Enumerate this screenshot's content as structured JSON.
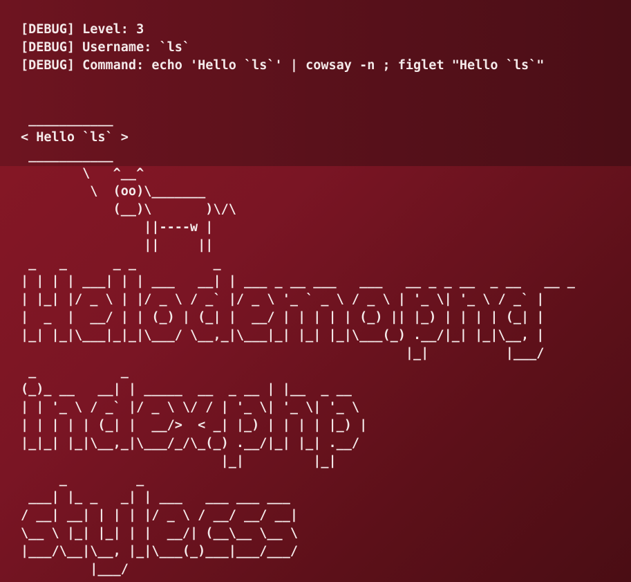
{
  "debug": {
    "level_line": "[DEBUG] Level: 3",
    "username_line": "[DEBUG] Username: `ls`",
    "command_line": "[DEBUG] Command: echo 'Hello `ls`' | cowsay -n ; figlet \"Hello `ls`\""
  },
  "cowsay": {
    "output": " ___________\n< Hello `ls` >\n ___________\n        \\   ^__^\n         \\  (oo)\\_______\n            (__)\\       )\\/\\\n                ||----w |\n                ||     ||"
  },
  "figlet": {
    "output": " _   _      _ _          _                                      \n| | | | ___| | | ___   __| | ___ _ __ ___   ___   __ _ _ __  _ __   __ _ \n| |_| |/ _ \\ | |/ _ \\ / _` |/ _ \\ '_ ` _ \\ / _ \\ | '_ \\| '_ \\ / _` |\n|  _  |  __/ | | (_) | (_| |  __/ | | | | | (_) || |_) | | | | (_| |\n|_| |_|\\___|_|_|\\___/ \\__,_|\\___|_| |_| |_|\\___(_) .__/|_| |_|\\__, |\n                                                  |_|          |___/ \n _           _                                \n(_)_ __   __| | _____  __  _ __ | |__  _ __  \n| | '_ \\ / _` |/ _ \\ \\/ / | '_ \\| '_ \\| '_ \\ \n| | | | | (_| |  __/>  < _| |_) | | | | |_) |\n|_|_| |_|\\__,_|\\___/_/\\_(_) .__/|_| |_| .__/ \n                          |_|         |_|    \n     _         _                        \n ___| |_ _   _| | ___   ___ ___ ___ \n/ __| __| | | | |/ _ \\ / __/ __/ __|\n\\__ \\ |_| |_| | |  __/| (__\\__ \\__ \\\n|___/\\__|\\__, |_|\\___(_)___|___/___/\n         |___/                      "
  }
}
